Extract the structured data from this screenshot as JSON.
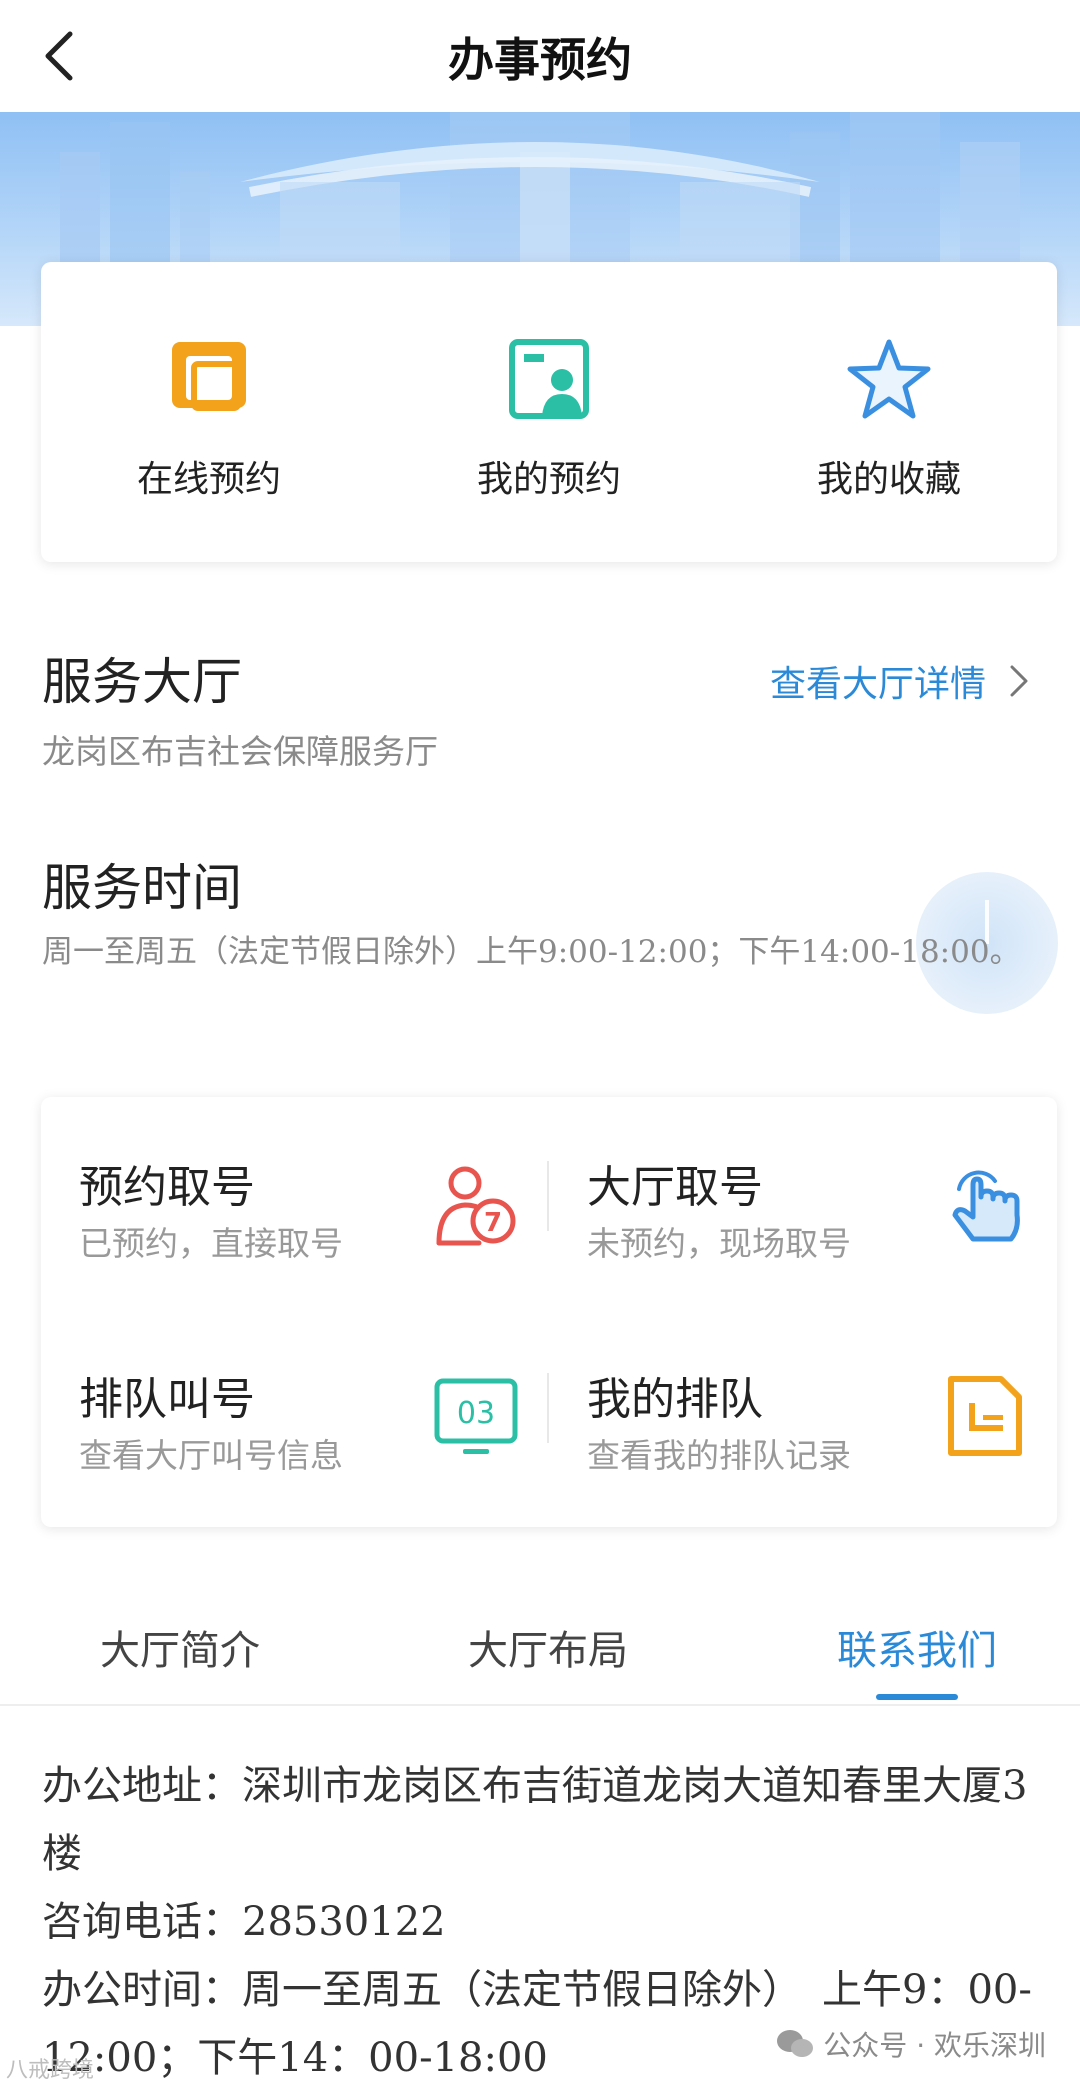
{
  "header": {
    "title": "办事预约"
  },
  "quick_actions": [
    {
      "label": "在线预约",
      "icon": "online-booking-icon"
    },
    {
      "label": "我的预约",
      "icon": "my-booking-icon"
    },
    {
      "label": "我的收藏",
      "icon": "star-icon"
    }
  ],
  "service_hall": {
    "title": "服务大厅",
    "name": "龙岗区布吉社会保障服务厅",
    "detail_link": "查看大厅详情"
  },
  "service_time": {
    "title": "服务时间",
    "text": "周一至周五（法定节假日除外）上午9:00-12:00；下午14:00-18:00。"
  },
  "tiles": [
    {
      "title": "预约取号",
      "sub": "已预约，直接取号",
      "icon": "person-number-7-icon",
      "color": "#e8554e"
    },
    {
      "title": "大厅取号",
      "sub": "未预约，现场取号",
      "icon": "tap-hand-icon",
      "color": "#3a8fe0"
    },
    {
      "title": "排队叫号",
      "sub": "查看大厅叫号信息",
      "icon": "monitor-03-icon",
      "color": "#2bbfa6"
    },
    {
      "title": "我的排队",
      "sub": "查看我的排队记录",
      "icon": "document-icon",
      "color": "#f3a21c"
    }
  ],
  "tile_icon_text": {
    "badge": "7",
    "screen": "03"
  },
  "tabs": [
    {
      "label": "大厅简介"
    },
    {
      "label": "大厅布局"
    },
    {
      "label": "联系我们",
      "active": true
    }
  ],
  "contact": {
    "address_label": "办公地址：",
    "address": "深圳市龙岗区布吉街道龙岗大道知春里大厦3楼",
    "phone_label": "咨询电话：",
    "phone": "28530122",
    "hours_label": "办公时间：",
    "hours": "周一至周五（法定节假日除外）　上午9：00-12:00；下午14：00-18:00"
  },
  "watermark": {
    "right": "公众号 · 欢乐深圳",
    "left": "八戒跨境"
  },
  "colors": {
    "accent": "#2b8ad8",
    "orange": "#f3a21c",
    "teal": "#2bbfa6",
    "red": "#e8554e"
  }
}
